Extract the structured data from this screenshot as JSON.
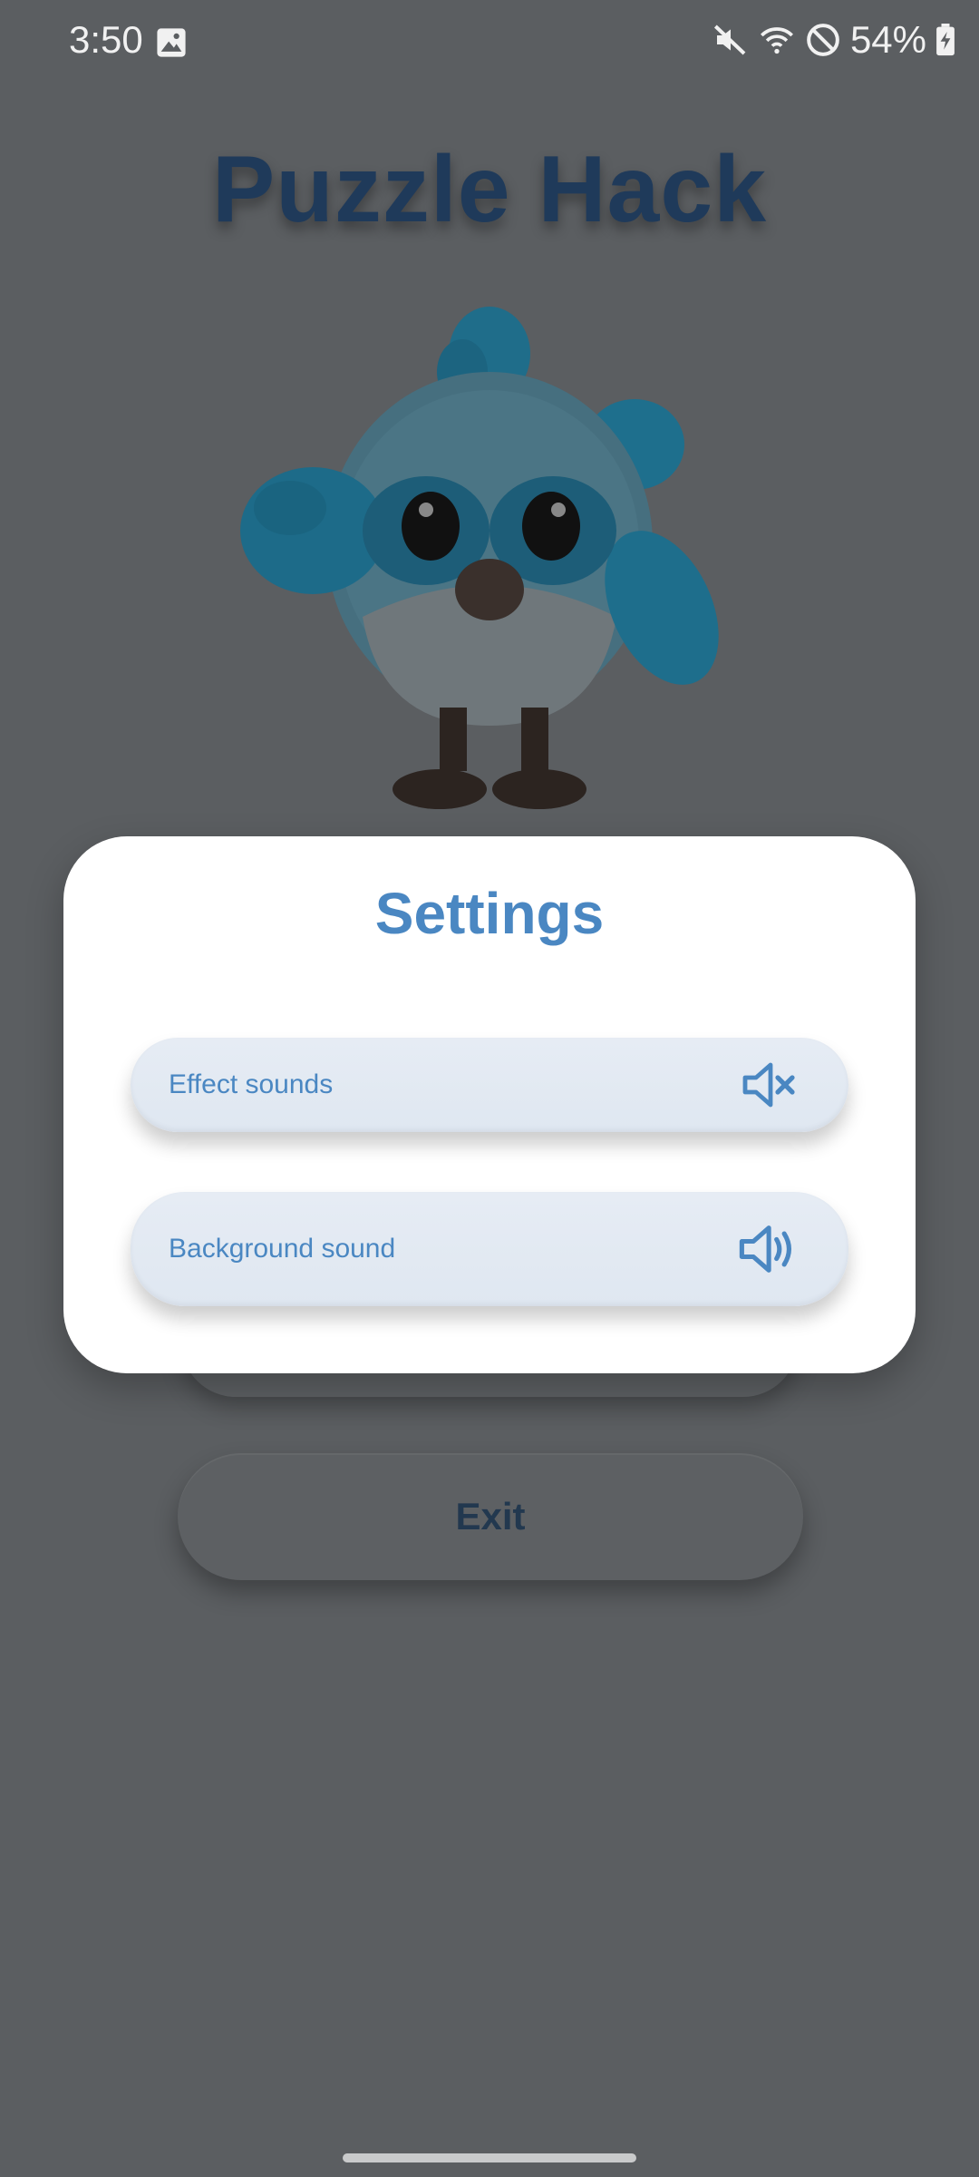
{
  "status_bar": {
    "time": "3:50",
    "battery": "54%",
    "icons": [
      "gallery-icon",
      "mute-icon",
      "wifi-icon",
      "do-not-disturb-icon",
      "battery-charging-icon"
    ]
  },
  "game": {
    "title": "Puzzle Hack",
    "exit_label": "Exit"
  },
  "settings": {
    "title": "Settings",
    "rows": [
      {
        "label": "Effect sounds",
        "state_icon": "volume-muted-icon"
      },
      {
        "label": "Background sound",
        "state_icon": "volume-on-icon"
      }
    ]
  },
  "colors": {
    "accent": "#4a87c2",
    "overlay_background": "#5b5e61",
    "title_dark": "#1f3a5a"
  }
}
